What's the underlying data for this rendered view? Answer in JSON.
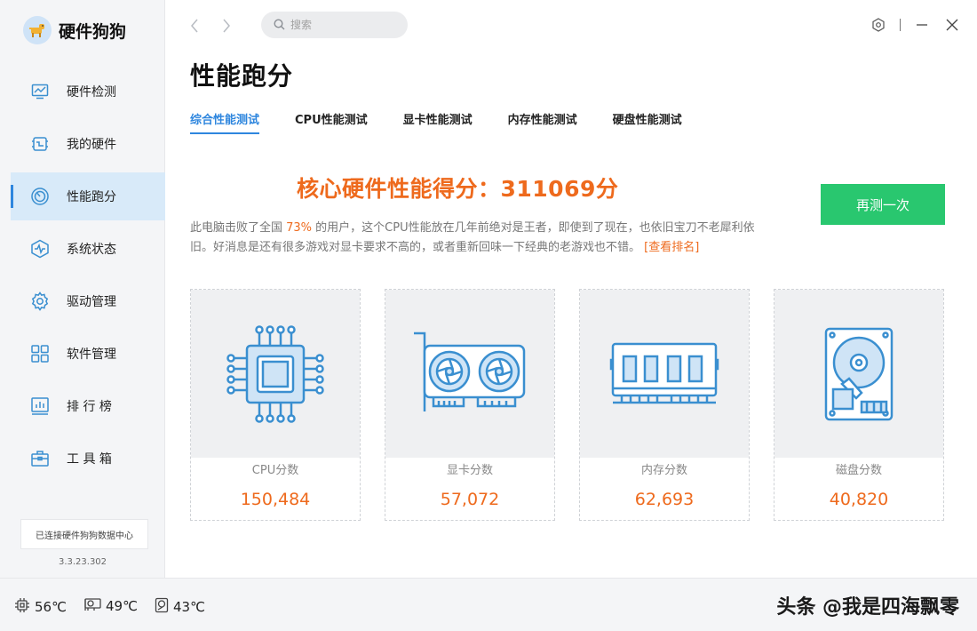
{
  "app": {
    "name": "硬件狗狗",
    "version": "3.3.23.302",
    "connection_status": "已连接硬件狗狗数据中心"
  },
  "sidebar": {
    "items": [
      {
        "label": "硬件检测",
        "icon": "monitor-icon",
        "active": false
      },
      {
        "label": "我的硬件",
        "icon": "chip-icon",
        "active": false
      },
      {
        "label": "性能跑分",
        "icon": "speedometer-icon",
        "active": true
      },
      {
        "label": "系统状态",
        "icon": "pulse-icon",
        "active": false
      },
      {
        "label": "驱动管理",
        "icon": "gear-icon",
        "active": false
      },
      {
        "label": "软件管理",
        "icon": "grid-icon",
        "active": false
      },
      {
        "label": "排 行 榜",
        "icon": "bar-chart-icon",
        "active": false
      },
      {
        "label": "工 具 箱",
        "icon": "toolbox-icon",
        "active": false
      }
    ]
  },
  "topbar": {
    "search_placeholder": "搜索"
  },
  "main": {
    "title": "性能跑分",
    "tabs": [
      {
        "label": "综合性能测试",
        "active": true
      },
      {
        "label": "CPU性能测试",
        "active": false
      },
      {
        "label": "显卡性能测试",
        "active": false
      },
      {
        "label": "内存性能测试",
        "active": false
      },
      {
        "label": "硬盘性能测试",
        "active": false
      }
    ],
    "score_text": "核心硬件性能得分：311069分",
    "retest_label": "再测一次",
    "desc_prefix": "此电脑击败了全国 ",
    "desc_percent": "73%",
    "desc_body": " 的用户，这个CPU性能放在几年前绝对是王者，即使到了现在，也依旧宝刀不老犀利依旧。好消息是还有很多游戏对显卡要求不高的，或者重新回味一下经典的老游戏也不错。 ",
    "desc_link": "[查看排名]",
    "cards": [
      {
        "label": "CPU分数",
        "value": "150,484",
        "icon": "cpu-icon"
      },
      {
        "label": "显卡分数",
        "value": "57,072",
        "icon": "graphics-card-icon"
      },
      {
        "label": "内存分数",
        "value": "62,693",
        "icon": "memory-icon"
      },
      {
        "label": "磁盘分数",
        "value": "40,820",
        "icon": "hard-disk-icon"
      }
    ]
  },
  "statusbar": {
    "cpu_temp": "56℃",
    "gpu_temp": "49℃",
    "disk_temp": "43℃",
    "watermark": "头条 @我是四海飘零"
  },
  "colors": {
    "accent": "#2e86de",
    "score_orange": "#ee6a1d",
    "button_green": "#29c76f",
    "icon_blue": "#3a8fd0"
  }
}
